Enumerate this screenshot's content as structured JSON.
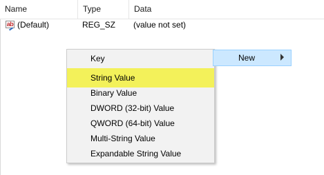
{
  "columns": {
    "name": "Name",
    "type": "Type",
    "data": "Data"
  },
  "row": {
    "icon": "string-value-icon",
    "icon_text": "ab",
    "name": "(Default)",
    "type": "REG_SZ",
    "data": "(value not set)"
  },
  "context_menu": {
    "key_label": "Key",
    "new_label": "New",
    "items": [
      "String Value",
      "Binary Value",
      "DWORD (32-bit) Value",
      "QWORD (64-bit) Value",
      "Multi-String Value",
      "Expandable String Value"
    ],
    "highlighted_item": "String Value"
  },
  "colors": {
    "menu_background": "#f2f2f2",
    "hover_background": "#cce8ff",
    "highlight": "#f3f15a"
  }
}
